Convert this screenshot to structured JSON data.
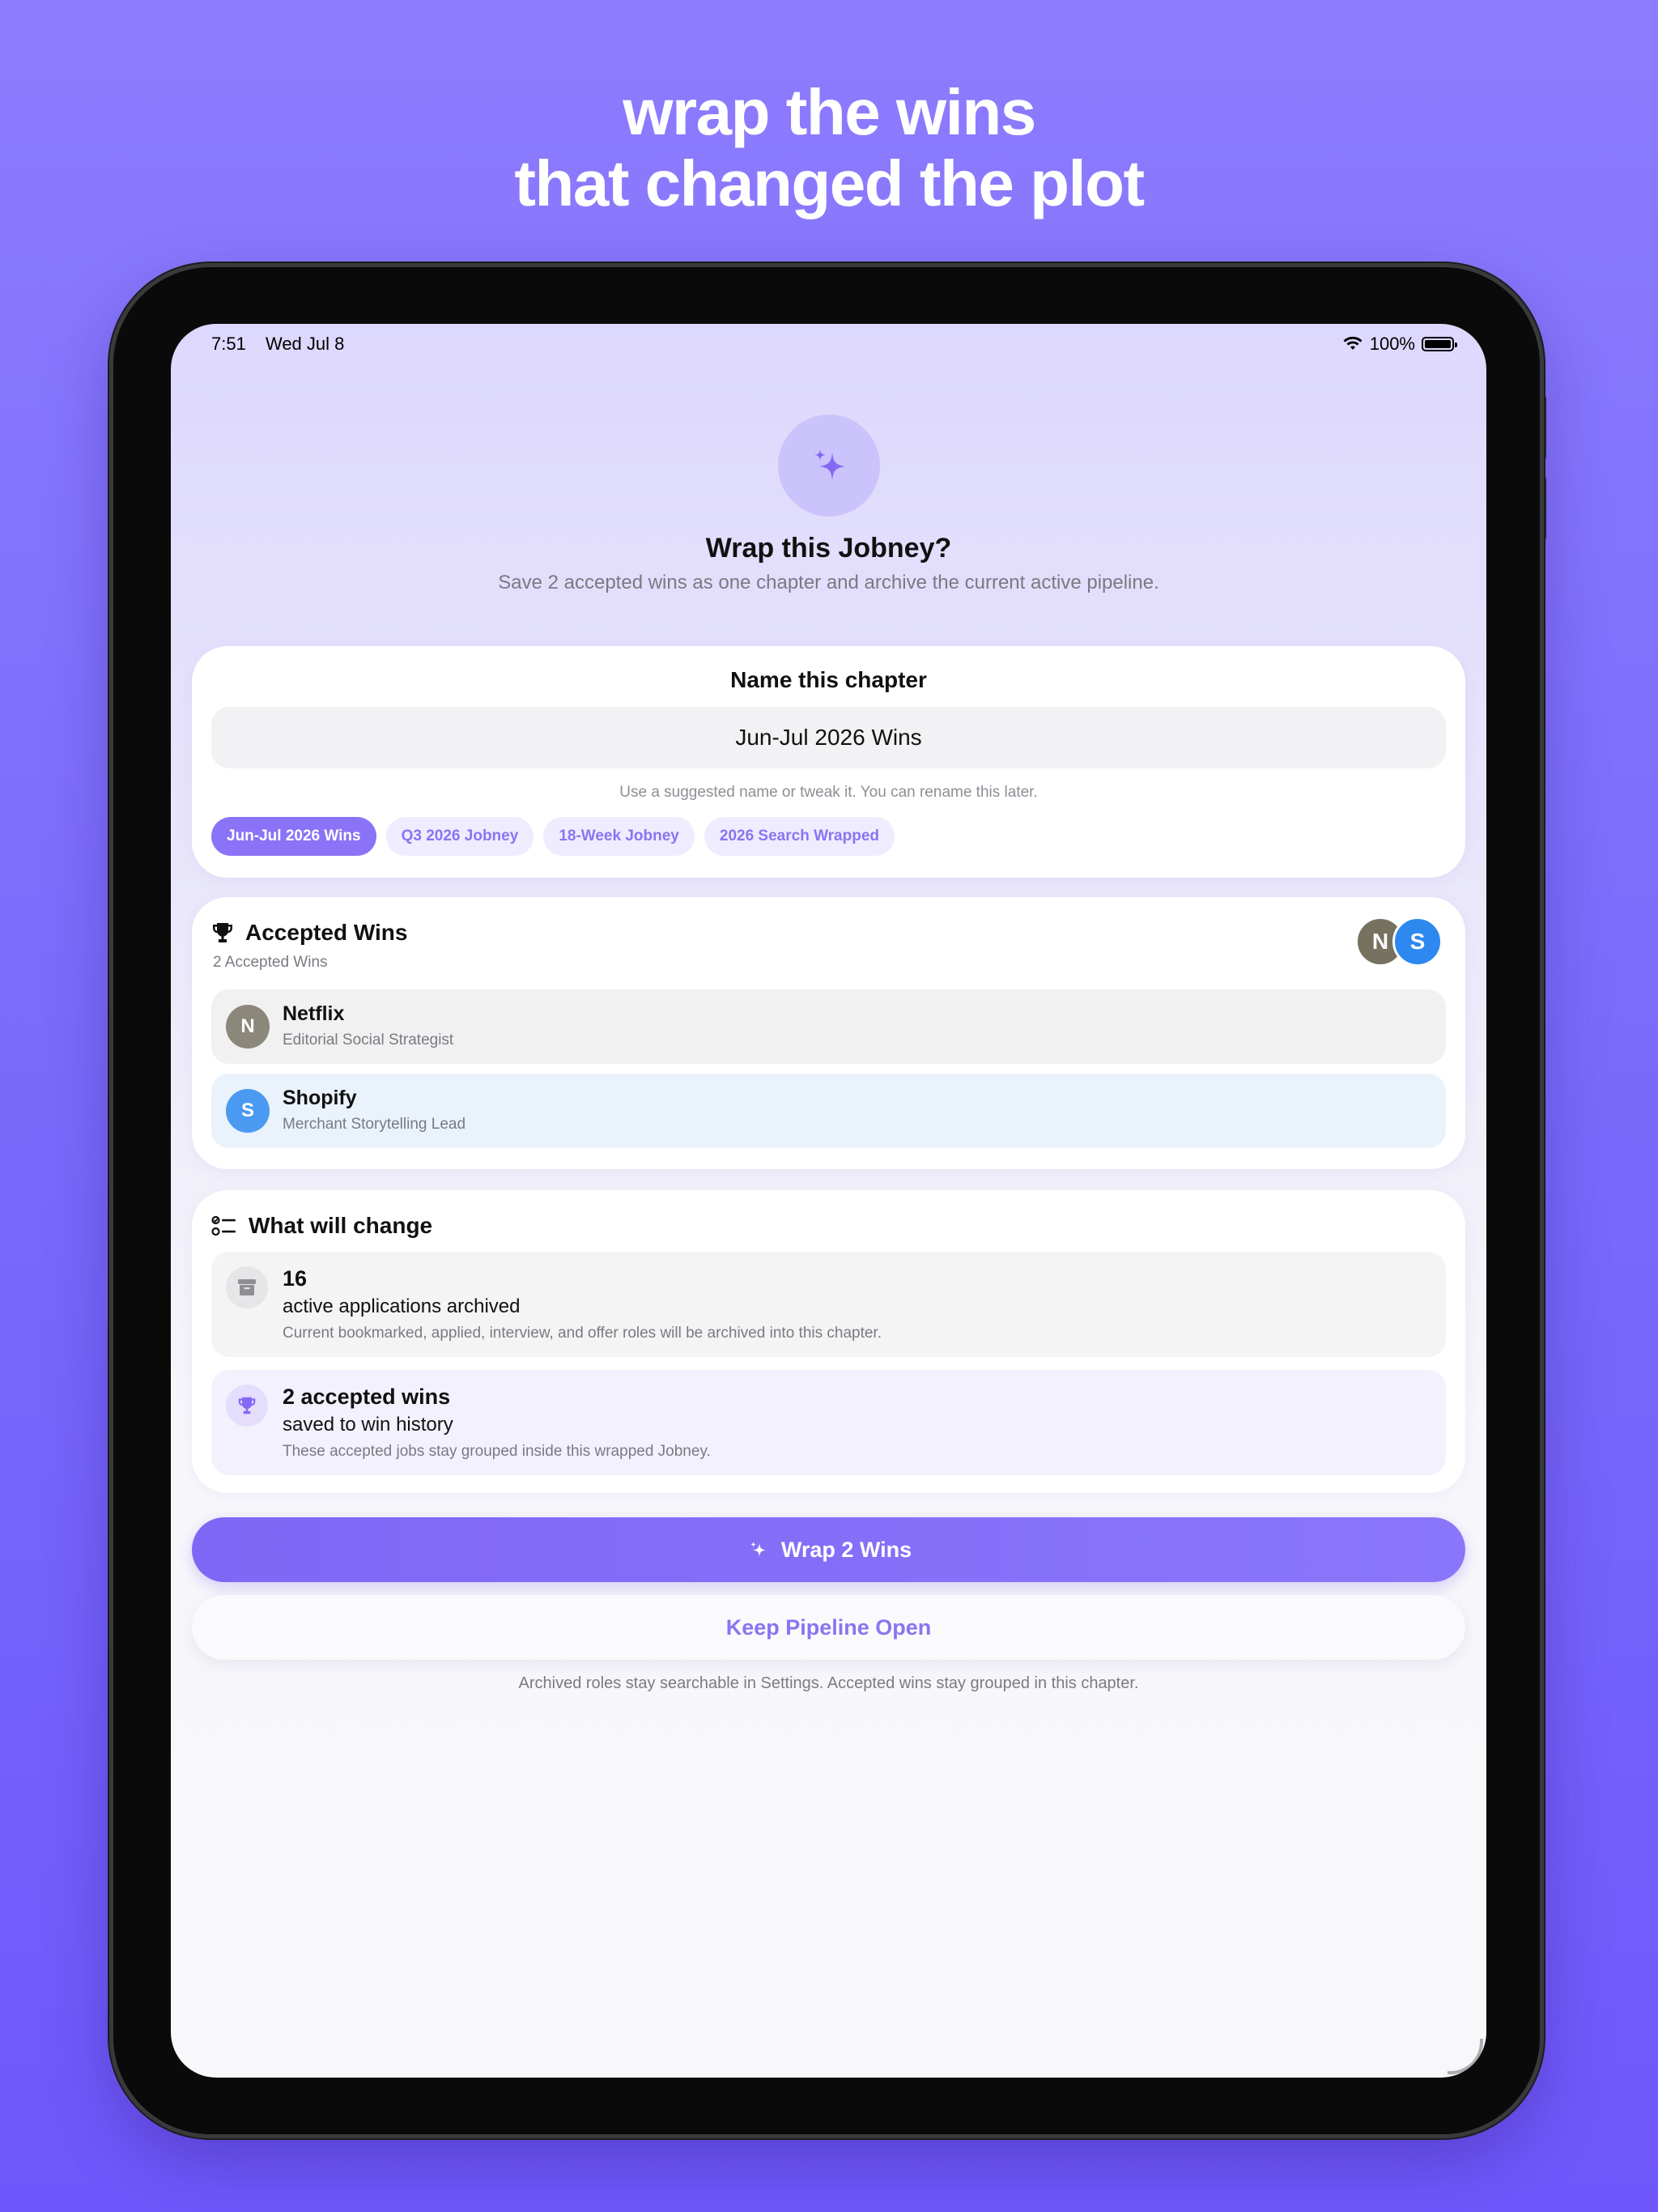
{
  "headline": {
    "line1": "wrap the wins",
    "line2": "that changed the plot"
  },
  "status_bar": {
    "time": "7:51",
    "date": "Wed Jul 8",
    "battery_percent": "100%"
  },
  "hero": {
    "icon": "sparkles-icon",
    "title": "Wrap this Jobney?",
    "subtitle": "Save 2 accepted wins as one chapter and archive the current active pipeline."
  },
  "name_card": {
    "title": "Name this chapter",
    "input_value": "Jun-Jul 2026 Wins",
    "hint": "Use a suggested name or tweak it. You can rename this later.",
    "chips": [
      {
        "label": "Jun-Jul 2026 Wins",
        "selected": true
      },
      {
        "label": "Q3 2026 Jobney",
        "selected": false
      },
      {
        "label": "18-Week Jobney",
        "selected": false
      },
      {
        "label": "2026 Search Wrapped",
        "selected": false
      }
    ]
  },
  "wins_card": {
    "icon": "trophy-icon",
    "title": "Accepted Wins",
    "subtitle": "2 Accepted Wins",
    "avatars": [
      "N",
      "S"
    ],
    "items": [
      {
        "initial": "N",
        "company": "Netflix",
        "role": "Editorial Social Strategist"
      },
      {
        "initial": "S",
        "company": "Shopify",
        "role": "Merchant Storytelling Lead"
      }
    ]
  },
  "changes_card": {
    "icon": "checklist-icon",
    "title": "What will change",
    "items": [
      {
        "icon": "archive-box-icon",
        "big": "16",
        "mid": "active applications archived",
        "small": "Current bookmarked, applied, interview, and offer roles will be archived into this chapter."
      },
      {
        "icon": "trophy-icon",
        "big": "2 accepted wins",
        "mid": "saved to win history",
        "small": "These accepted jobs stay grouped inside this wrapped Jobney."
      }
    ]
  },
  "actions": {
    "primary_label": "Wrap 2 Wins",
    "secondary_label": "Keep Pipeline Open",
    "footer_note": "Archived roles stay searchable in Settings. Accepted wins stay grouped in this chapter."
  },
  "colors": {
    "accent": "#8b73f7",
    "background_top": "#8d7cfd",
    "background_bottom": "#6f57fb"
  }
}
